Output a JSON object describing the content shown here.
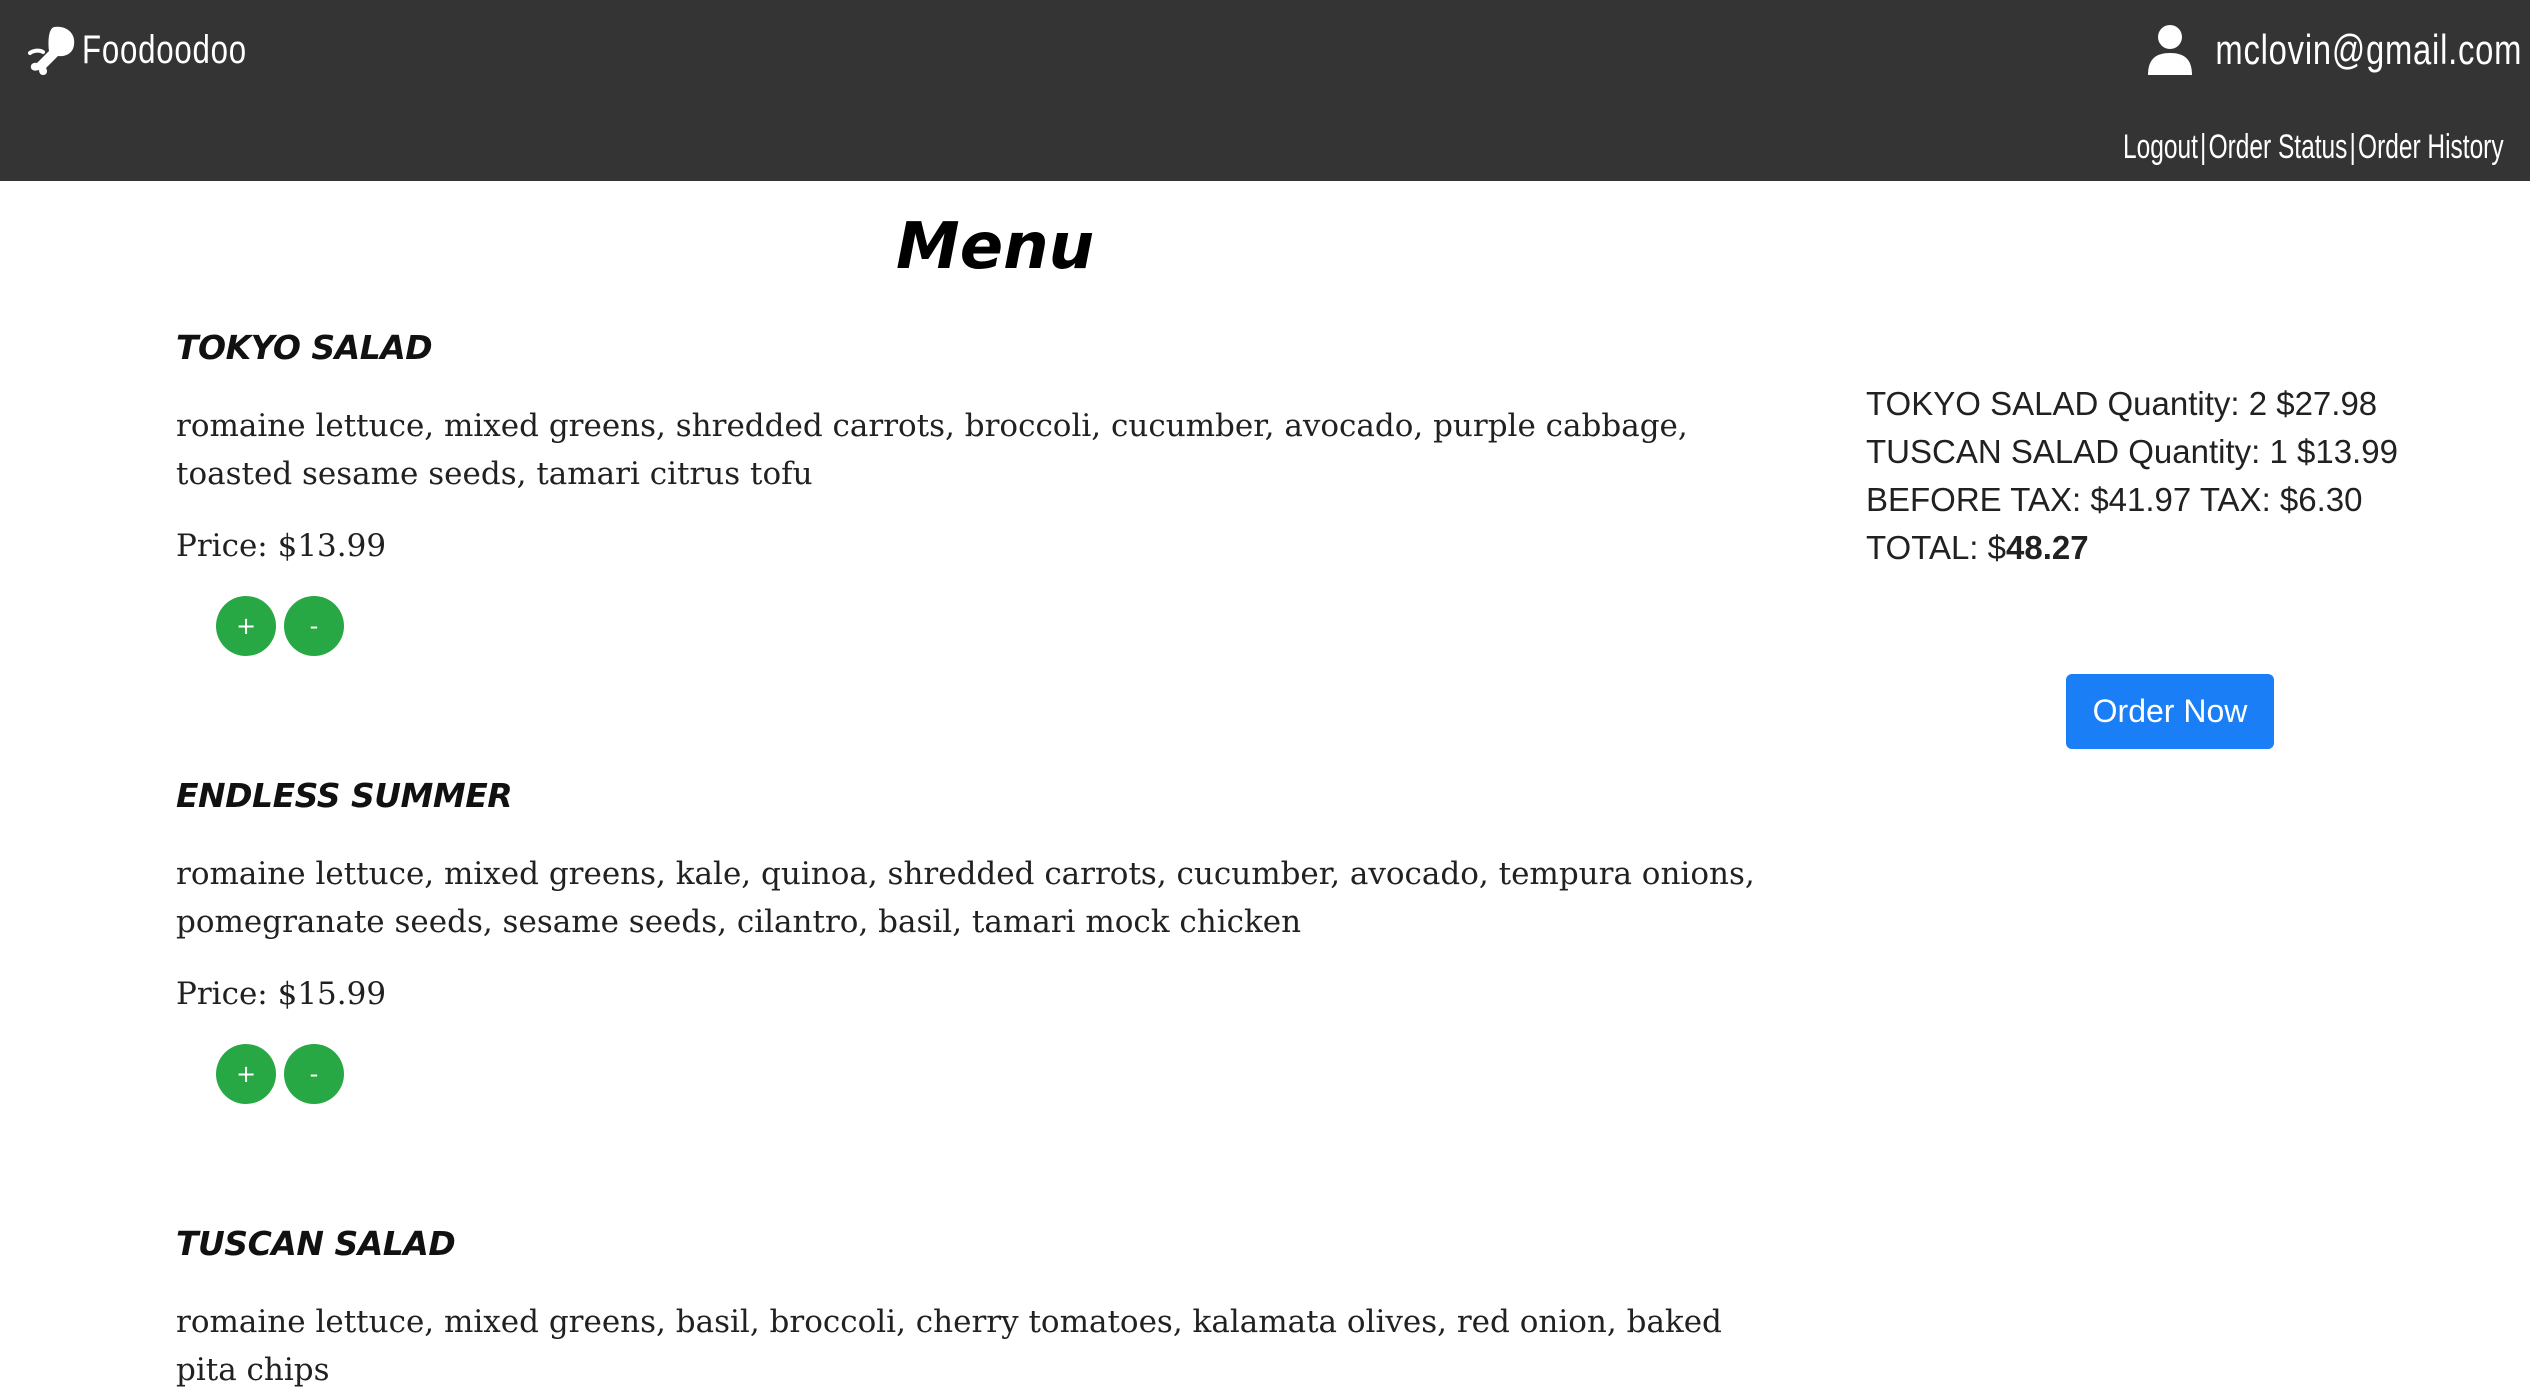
{
  "header": {
    "brand_name": "Foodoodoo",
    "user_email": "mclovin@gmail.com",
    "nav": [
      {
        "label": "Logout"
      },
      {
        "label": "Order Status"
      },
      {
        "label": "Order History"
      }
    ],
    "nav_separator": "|"
  },
  "page": {
    "title": "Menu"
  },
  "menu": {
    "items": [
      {
        "name": "TOKYO SALAD",
        "description": "romaine lettuce, mixed greens, shredded carrots, broccoli, cucumber, avocado, purple cabbage, toasted sesame seeds, tamari citrus tofu",
        "price_label": "Price: $13.99",
        "add_label": "+",
        "remove_label": "-"
      },
      {
        "name": "ENDLESS SUMMER",
        "description": "romaine lettuce, mixed greens, kale, quinoa, shredded carrots, cucumber, avocado, tempura onions, pomegranate seeds, sesame seeds, cilantro, basil, tamari mock chicken",
        "price_label": "Price: $15.99",
        "add_label": "+",
        "remove_label": "-"
      },
      {
        "name": "TUSCAN SALAD",
        "description": "romaine lettuce, mixed greens, basil, broccoli, cherry tomatoes, kalamata olives, red onion, baked pita chips"
      }
    ]
  },
  "cart": {
    "lines": [
      "TOKYO SALAD Quantity: 2 $27.98",
      "TUSCAN SALAD Quantity: 1 $13.99",
      "BEFORE TAX: $41.97 TAX: $6.30"
    ],
    "total_prefix": "TOTAL: $",
    "total_value": "48.27",
    "order_button_label": "Order Now"
  },
  "colors": {
    "header_bg": "#343434",
    "qty_button": "#28a745",
    "primary_button": "#1a7ff7"
  }
}
